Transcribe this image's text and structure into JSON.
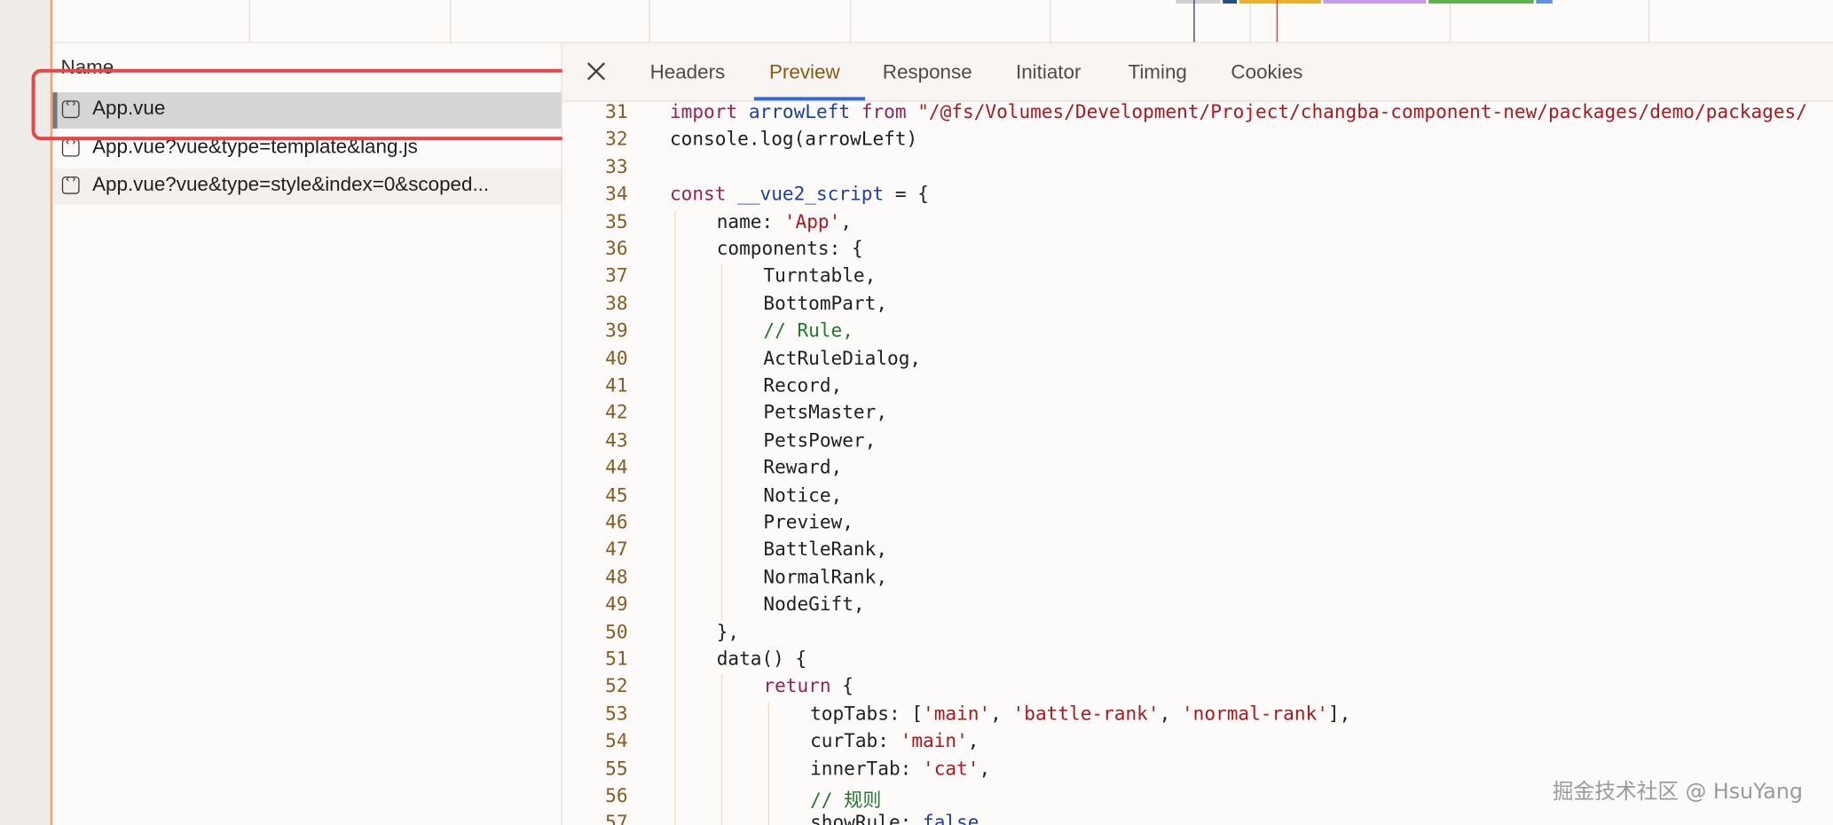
{
  "list": {
    "header": "Name",
    "rows": [
      {
        "name": "App.vue",
        "icon": "source-file-icon"
      },
      {
        "name": "App.vue?vue&type=template&lang.js",
        "icon": "source-file-icon"
      },
      {
        "name": "App.vue?vue&type=style&index=0&scoped...",
        "icon": "source-file-icon"
      }
    ],
    "selected": "App.vue"
  },
  "details": {
    "close_icon": "close-icon",
    "tabs": [
      "Headers",
      "Preview",
      "Response",
      "Initiator",
      "Timing",
      "Cookies"
    ],
    "active_tab": "Preview"
  },
  "code": {
    "lines": [
      {
        "n": "31",
        "indent": 0,
        "parts": [
          [
            "kw",
            "import "
          ],
          [
            "nm",
            "arrowLeft"
          ],
          [
            "kw",
            " from "
          ],
          [
            "st",
            "\"/@fs/Volumes/Development/Project/changba-component-new/packages/demo/packages/"
          ]
        ]
      },
      {
        "n": "32",
        "indent": 0,
        "parts": [
          [
            "",
            "console.log(arrowLeft)"
          ]
        ]
      },
      {
        "n": "33",
        "indent": 0,
        "parts": [
          [
            "",
            ""
          ]
        ]
      },
      {
        "n": "34",
        "indent": 0,
        "parts": [
          [
            "kw",
            "const "
          ],
          [
            "nm",
            "__vue2_script"
          ],
          [
            "",
            " = {"
          ]
        ]
      },
      {
        "n": "35",
        "indent": 1,
        "parts": [
          [
            "",
            "name: "
          ],
          [
            "st",
            "'App'"
          ],
          [
            "",
            ","
          ]
        ]
      },
      {
        "n": "36",
        "indent": 1,
        "parts": [
          [
            "",
            "components: {"
          ]
        ]
      },
      {
        "n": "37",
        "indent": 2,
        "parts": [
          [
            "",
            "Turntable,"
          ]
        ]
      },
      {
        "n": "38",
        "indent": 2,
        "parts": [
          [
            "",
            "BottomPart,"
          ]
        ]
      },
      {
        "n": "39",
        "indent": 2,
        "parts": [
          [
            "cm",
            "// Rule,"
          ]
        ]
      },
      {
        "n": "40",
        "indent": 2,
        "parts": [
          [
            "",
            "ActRuleDialog,"
          ]
        ]
      },
      {
        "n": "41",
        "indent": 2,
        "parts": [
          [
            "",
            "Record,"
          ]
        ]
      },
      {
        "n": "42",
        "indent": 2,
        "parts": [
          [
            "",
            "PetsMaster,"
          ]
        ]
      },
      {
        "n": "43",
        "indent": 2,
        "parts": [
          [
            "",
            "PetsPower,"
          ]
        ]
      },
      {
        "n": "44",
        "indent": 2,
        "parts": [
          [
            "",
            "Reward,"
          ]
        ]
      },
      {
        "n": "45",
        "indent": 2,
        "parts": [
          [
            "",
            "Notice,"
          ]
        ]
      },
      {
        "n": "46",
        "indent": 2,
        "parts": [
          [
            "",
            "Preview,"
          ]
        ]
      },
      {
        "n": "47",
        "indent": 2,
        "parts": [
          [
            "",
            "BattleRank,"
          ]
        ]
      },
      {
        "n": "48",
        "indent": 2,
        "parts": [
          [
            "",
            "NormalRank,"
          ]
        ]
      },
      {
        "n": "49",
        "indent": 2,
        "parts": [
          [
            "",
            "NodeGift,"
          ]
        ]
      },
      {
        "n": "50",
        "indent": 1,
        "parts": [
          [
            "",
            "},"
          ]
        ]
      },
      {
        "n": "51",
        "indent": 1,
        "parts": [
          [
            "",
            "data() {"
          ]
        ]
      },
      {
        "n": "52",
        "indent": 2,
        "parts": [
          [
            "kw",
            "return"
          ],
          [
            "",
            " {"
          ]
        ]
      },
      {
        "n": "53",
        "indent": 3,
        "parts": [
          [
            "",
            "topTabs: ["
          ],
          [
            "st",
            "'main'"
          ],
          [
            "",
            ", "
          ],
          [
            "st",
            "'battle-rank'"
          ],
          [
            "",
            ", "
          ],
          [
            "st",
            "'normal-rank'"
          ],
          [
            "",
            "],"
          ]
        ]
      },
      {
        "n": "54",
        "indent": 3,
        "parts": [
          [
            "",
            "curTab: "
          ],
          [
            "st",
            "'main'"
          ],
          [
            "",
            ","
          ]
        ]
      },
      {
        "n": "55",
        "indent": 3,
        "parts": [
          [
            "",
            "innerTab: "
          ],
          [
            "st",
            "'cat'"
          ],
          [
            "",
            ","
          ]
        ]
      },
      {
        "n": "56",
        "indent": 3,
        "parts": [
          [
            "cm",
            "// 规则"
          ]
        ]
      },
      {
        "n": "57",
        "indent": 3,
        "parts": [
          [
            "",
            "showRule: "
          ],
          [
            "nm",
            "false"
          ],
          [
            "",
            ","
          ]
        ]
      }
    ]
  },
  "watermark": "掘金技术社区 @ HsuYang",
  "colors": {
    "accent": "#2f6ae0",
    "highlight": "#e84646",
    "line_number": "#8c5a1f"
  }
}
